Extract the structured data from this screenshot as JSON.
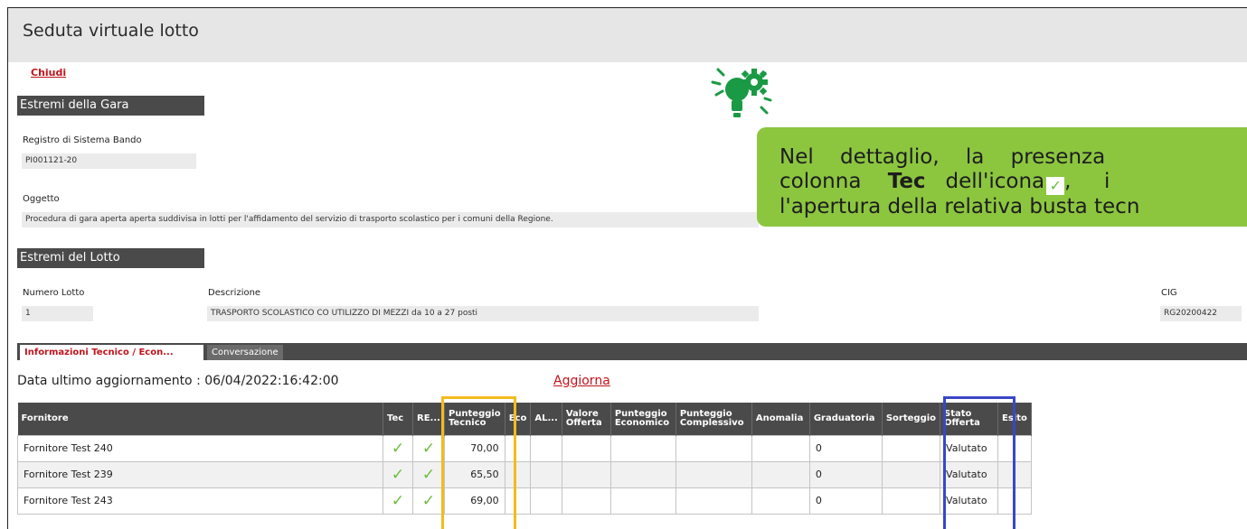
{
  "page": {
    "title": "Seduta virtuale lotto",
    "close_label": "Chiudi"
  },
  "gara": {
    "section_title": "Estremi della Gara",
    "registro_label": "Registro di Sistema Bando",
    "registro_value": "PI001121-20",
    "oggetto_label": "Oggetto",
    "oggetto_value": "Procedura di gara aperta aperta suddivisa in lotti per l'affidamento del servizio di trasporto scolastico per i comuni della Regione."
  },
  "lotto": {
    "section_title": "Estremi del Lotto",
    "numero_label": "Numero Lotto",
    "numero_value": "1",
    "descrizione_label": "Descrizione",
    "descrizione_value": "TRASPORTO SCOLASTICO CO UTILIZZO DI MEZZI da 10 a 27 posti",
    "cig_label": "CIG",
    "cig_value": "RG20200422"
  },
  "tabs": [
    {
      "label": "Informazioni Tecnico / Econ..."
    },
    {
      "label": "Conversazione"
    }
  ],
  "update": {
    "label": "Data ultimo aggiornamento : 06/04/2022:16:42:00",
    "link": "Aggiorna"
  },
  "table": {
    "headers": {
      "fornitore": "Fornitore",
      "tec": "Tec",
      "re": "RE...",
      "punteggio_tecnico": "Punteggio Tecnico",
      "eco": "Eco",
      "al": "AL...",
      "valore_offerta": "Valore Offerta",
      "punteggio_economico": "Punteggio Economico",
      "punteggio_complessivo": "Punteggio Complessivo",
      "anomalia": "Anomalia",
      "graduatoria": "Graduatoria",
      "sorteggio": "Sorteggio",
      "stato_offerta": "Stato Offerta",
      "esito": "Esito"
    },
    "rows": [
      {
        "fornitore": "Fornitore Test 240",
        "tec": "✓",
        "re": "✓",
        "punteggio_tecnico": "70,00",
        "graduatoria": "0",
        "stato_offerta": "Valutato"
      },
      {
        "fornitore": "Fornitore Test 239",
        "tec": "✓",
        "re": "✓",
        "punteggio_tecnico": "65,50",
        "graduatoria": "0",
        "stato_offerta": "Valutato"
      },
      {
        "fornitore": "Fornitore Test 243",
        "tec": "✓",
        "re": "✓",
        "punteggio_tecnico": "69,00",
        "graduatoria": "0",
        "stato_offerta": "Valutato"
      }
    ]
  },
  "callout": {
    "line1": "Nel    dettaglio,    la    presenza",
    "line2a": "colonna",
    "line2b": "Tec",
    "line2c": "dell'icona",
    "line2d": "i",
    "line3": "l'apertura della relativa busta tecn"
  },
  "colors": {
    "accent_red": "#c0131b",
    "header_dark": "#4a4a4a",
    "callout_green": "#8cc63f",
    "check_green": "#6cbb3c",
    "highlight_yellow": "#f3bb1c",
    "highlight_blue": "#3a46c7"
  },
  "icons": {
    "callout_icon": "lightbulb-gear-icon",
    "check_icon": "check-icon"
  }
}
